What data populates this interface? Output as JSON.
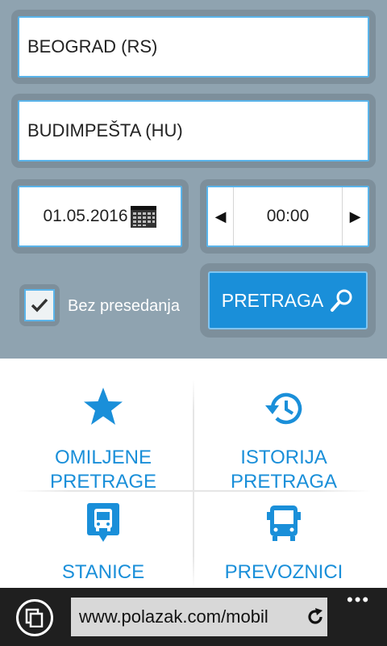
{
  "search": {
    "from": "BEOGRAD (RS)",
    "to": "BUDIMPEŠTA (HU)",
    "date": "01.05.2016",
    "time": "00:00",
    "time_prev_symbol": "◀",
    "time_next_symbol": "▶",
    "direct_only_label": "Bez presedanja",
    "direct_only_checked": true,
    "search_button_label": "PRETRAGA"
  },
  "menu": {
    "favorites": {
      "line1": "OMILJENE",
      "line2": "PRETRAGE",
      "icon": "star-icon"
    },
    "history": {
      "line1": "ISTORIJA",
      "line2": "PRETRAGA",
      "icon": "history-icon"
    },
    "stations": {
      "label": "STANICE",
      "icon": "bus-station-icon"
    },
    "carriers": {
      "label": "PREVOZNICI",
      "icon": "bus-icon"
    }
  },
  "browser": {
    "url": "www.polazak.com/mobil",
    "more_symbol": "•••"
  },
  "colors": {
    "accent": "#1a8fd9",
    "panel": "#8fa3b0",
    "field_border": "#5ab4ea",
    "browser_bar": "#1f1f1f"
  }
}
